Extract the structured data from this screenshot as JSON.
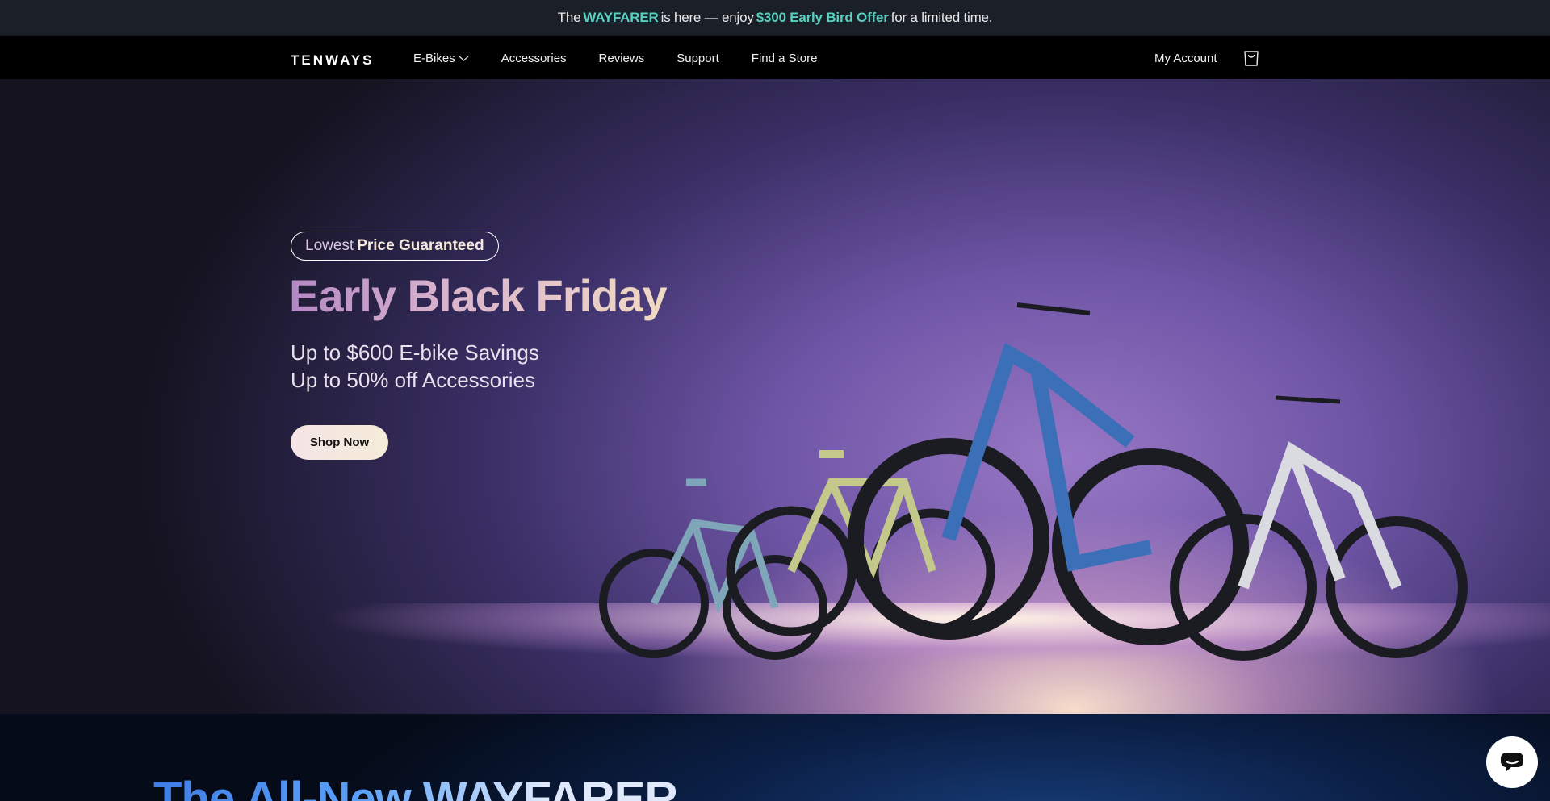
{
  "announcement": {
    "prefix": "The",
    "link": "WAYFARER",
    "middle": "is here — enjoy",
    "offer": "$300 Early Bird Offer",
    "suffix": "for a limited time."
  },
  "nav": {
    "logo": "TENWAYS",
    "items": [
      "E-Bikes",
      "Accessories",
      "Reviews",
      "Support",
      "Find a Store"
    ],
    "account": "My Account"
  },
  "hero": {
    "badge_light": "Lowest",
    "badge_bold": "Price Guaranteed",
    "title": "Early Black Friday",
    "line1": "Up to $600 E-bike Savings",
    "line2": "Up to 50% off Accessories",
    "cta": "Shop Now"
  },
  "lower": {
    "title": "The All-New WAYFARER"
  },
  "colors": {
    "accent": "#56d1c0",
    "topbar": "#1b1f28"
  },
  "icons": {
    "cart": "shopping-bag-icon",
    "chat": "chat-icon",
    "dropdown": "chevron-down-icon"
  }
}
